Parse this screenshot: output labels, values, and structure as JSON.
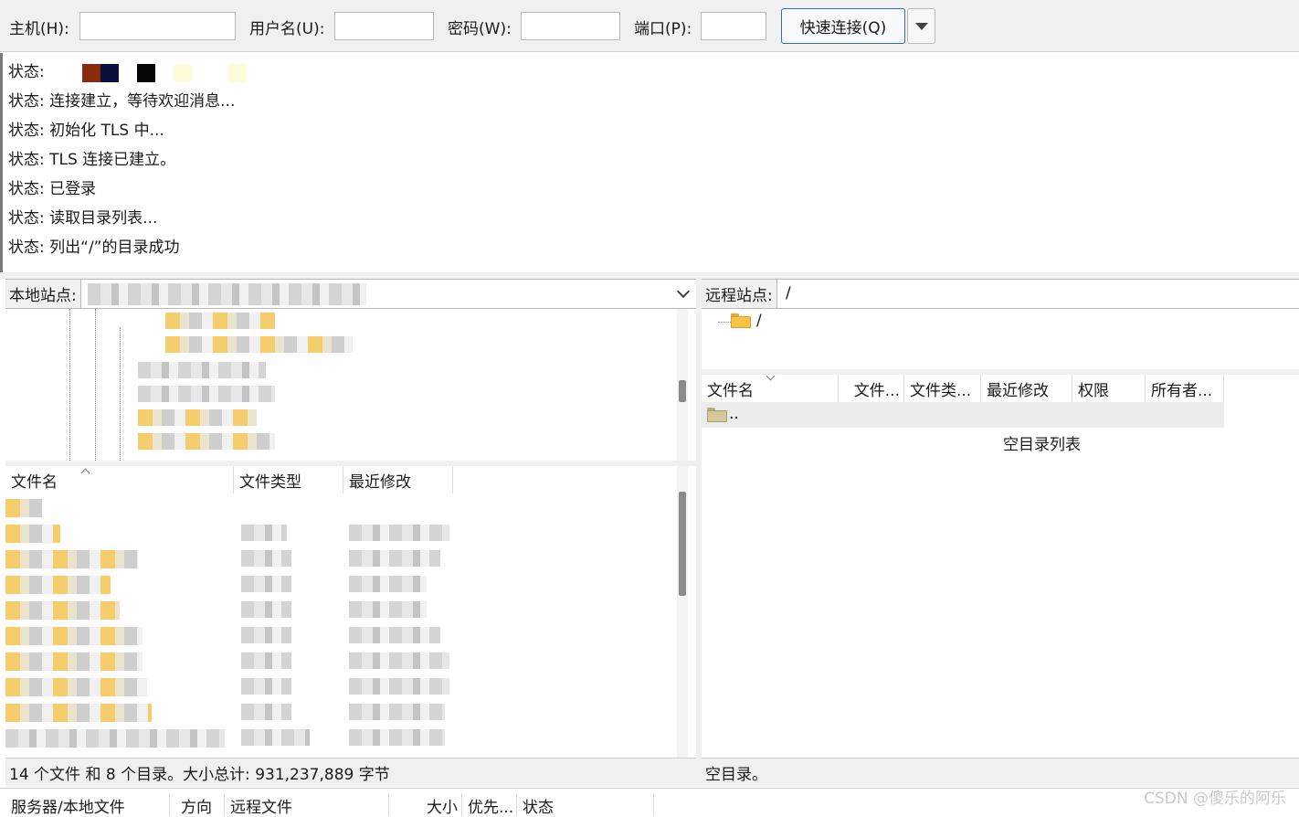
{
  "quick_connect": {
    "host_label": "主机(H):",
    "host_value": "",
    "user_label": "用户名(U):",
    "user_value": "",
    "password_label": "密码(W):",
    "password_value": "",
    "port_label": "端口(P):",
    "port_value": "",
    "connect_button": "快速连接(Q)",
    "dropdown_icon": "chevron-down-icon"
  },
  "log": {
    "lines": [
      "状态:",
      "状态: 连接建立，等待欢迎消息...",
      "状态: 初始化 TLS 中...",
      "状态: TLS 连接已建立。",
      "状态: 已登录",
      "状态: 读取目录列表...",
      "状态: 列出“/”的目录成功"
    ],
    "swatch_colors": [
      "#8a2c0c",
      "#0a0f3c",
      "#050505",
      "#fdfbd8",
      "#fdfbd8"
    ]
  },
  "local": {
    "site_label": "本地站点:",
    "columns": [
      "文件名",
      "文件类型",
      "最近修改"
    ],
    "status": "14 个文件 和 8 个目录。大小总计: 931,237,889 字节"
  },
  "remote": {
    "site_label": "远程站点:",
    "path": "/",
    "tree_root": "/",
    "columns": [
      "文件名",
      "文件...",
      "文件类...",
      "最近修改",
      "权限",
      "所有者..."
    ],
    "parent_entry": "..",
    "empty_message": "空目录列表",
    "status": "空目录。"
  },
  "queue": {
    "columns": [
      "服务器/本地文件",
      "方向",
      "远程文件",
      "大小",
      "优先...",
      "状态"
    ]
  },
  "watermark": "CSDN @傻乐的阿乐"
}
